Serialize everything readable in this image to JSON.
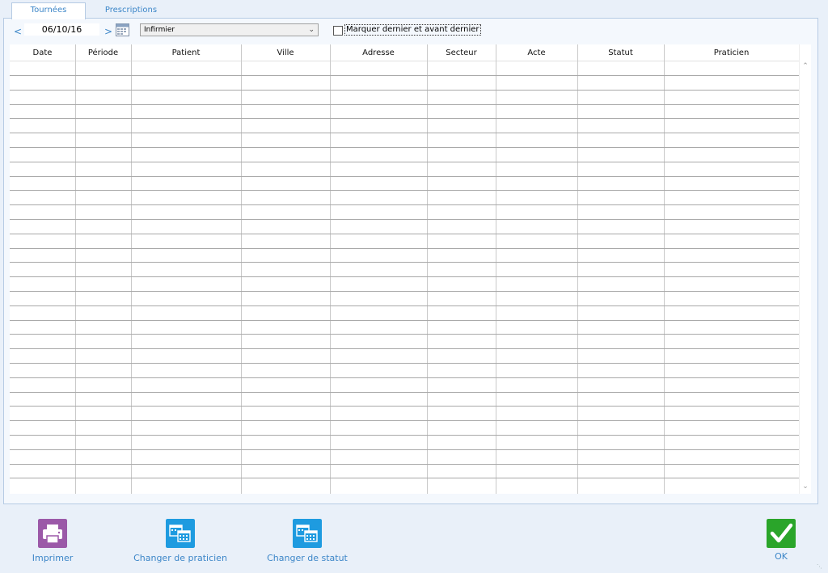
{
  "tabs": [
    {
      "label": "Tournées",
      "active": true
    },
    {
      "label": "Prescriptions",
      "active": false
    }
  ],
  "toolbar": {
    "prev_label": "<",
    "next_label": ">",
    "date_value": "06/10/16",
    "role_selected": "Infirmier",
    "checkbox_label": "Marquer dernier et avant dernier",
    "checkbox_checked": false
  },
  "table": {
    "columns": [
      "Date",
      "Période",
      "Patient",
      "Ville",
      "Adresse",
      "Secteur",
      "Acte",
      "Statut",
      "Praticien"
    ],
    "rows": []
  },
  "buttons": {
    "print_label": "Imprimer",
    "change_practitioner_label": "Changer de praticien",
    "change_status_label": "Changer de statut",
    "ok_label": "OK"
  },
  "colors": {
    "accent": "#3c86c8",
    "print_button": "#9b59a8",
    "calendar_button": "#1e9be0",
    "ok_button": "#2aa52a",
    "background": "#e9f0f9"
  },
  "icons": {
    "print": "printer-icon",
    "calendar": "calendar-icon",
    "ok": "checkmark-icon"
  }
}
